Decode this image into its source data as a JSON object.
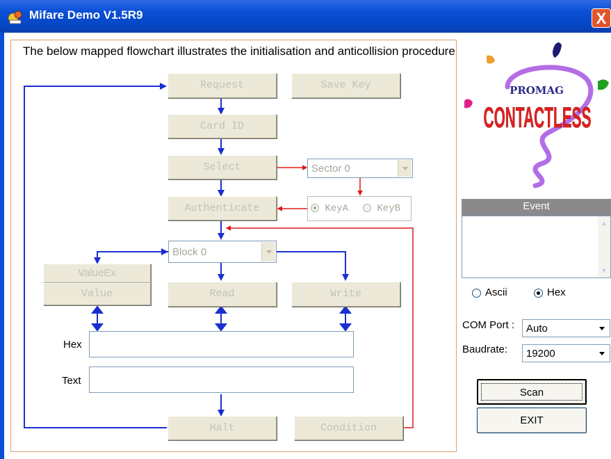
{
  "window": {
    "title": "Mifare Demo V1.5R9",
    "close_label": "X"
  },
  "description": "The below mapped flowchart illustrates the initialisation and anticollision procedure",
  "flow": {
    "request": "Request",
    "save_key": "Save Key",
    "card_id": "Card ID",
    "select": "Select",
    "sector": {
      "value": "Sector 0"
    },
    "authenticate": "Authenticate",
    "key_a": "KeyA",
    "key_b": "KeyB",
    "block": {
      "value": "Block 0"
    },
    "value_ex": "ValueEx",
    "value": "Value",
    "read": "Read",
    "write": "Write",
    "hex_label": "Hex",
    "text_label": "Text",
    "halt": "Halt",
    "condition": "Condition"
  },
  "logo": {
    "top_text": "PROMAG",
    "main_text": "CONTACTLESS"
  },
  "event": {
    "header": "Event"
  },
  "display_format": {
    "ascii": "Ascii",
    "hex": "Hex",
    "selected": "Hex"
  },
  "com_port": {
    "label": "COM Port :",
    "value": "Auto"
  },
  "baudrate": {
    "label": "Baudrate:",
    "value": "19200"
  },
  "buttons": {
    "scan": "Scan",
    "exit": "EXIT"
  },
  "colors": {
    "flow_blue": "#1a2fd0",
    "flow_red": "#e01818",
    "titlebar": "#0a4fd6"
  },
  "icons": {
    "app": "mifare-app-icon",
    "close": "close-icon",
    "dropdown": "chevron-down-icon"
  }
}
